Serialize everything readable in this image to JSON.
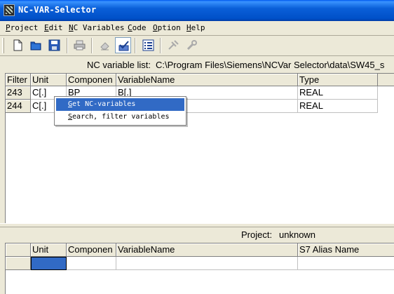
{
  "window": {
    "title": "NC-VAR-Selector"
  },
  "menu": [
    {
      "label": "Project",
      "key": "P",
      "rest": "roject"
    },
    {
      "label": "Edit",
      "key": "E",
      "rest": "dit"
    },
    {
      "label": "NC Variables",
      "key": "N",
      "rest": "C Variables"
    },
    {
      "label": "Code",
      "key": "C",
      "rest": "ode"
    },
    {
      "label": "Option",
      "key": "O",
      "rest": "ption"
    },
    {
      "label": "Help",
      "key": "H",
      "rest": "elp"
    }
  ],
  "toolbar": {
    "buttons": [
      "new-document-icon",
      "open-folder-icon",
      "save-disk-icon",
      "print-icon",
      "eraser-icon",
      "check-edit-icon",
      "list-icon",
      "tools-icon",
      "wrench-icon"
    ]
  },
  "nc_list": {
    "label": "NC variable list:",
    "path": "C:\\Program Files\\Siemens\\NCVar Selector\\data\\SW45_s",
    "columns": [
      "Filter",
      "Unit",
      "Componen",
      "VariableName",
      "Type"
    ],
    "rows": [
      {
        "filter": "243",
        "unit": "C[.]",
        "component": "BP",
        "variable": "B[.]",
        "type": "REAL"
      },
      {
        "filter": "244",
        "unit": "C[.]",
        "component": "",
        "variable": "",
        "type": "REAL"
      }
    ]
  },
  "project": {
    "label": "Project:",
    "name": "unknown"
  },
  "project_grid": {
    "columns": [
      "",
      "Unit",
      "Componen",
      "VariableName",
      "S7 Alias Name"
    ]
  },
  "context_menu": {
    "items": [
      {
        "label": "Get NC-variables",
        "key": "G",
        "rest": "et NC-variables"
      },
      {
        "label": "Search, filter variables",
        "key": "S",
        "rest": "earch, filter variables"
      }
    ]
  },
  "colors": {
    "title_blue": "#0a5fd8",
    "selection": "#316ac5",
    "face": "#ece9d8"
  }
}
